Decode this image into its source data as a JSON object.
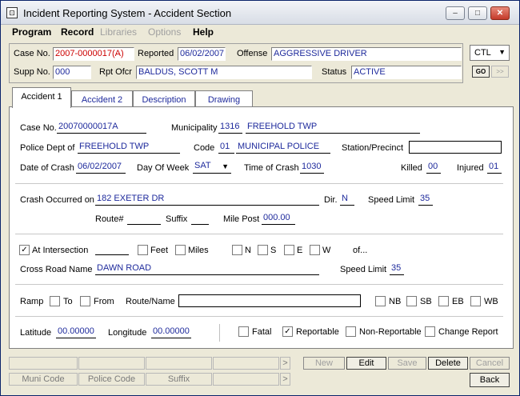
{
  "window": {
    "title": "Incident Reporting System - Accident Section",
    "controls": {
      "minimize": "‒",
      "maximize": "□",
      "close": "✕"
    }
  },
  "menu": [
    {
      "label": "Program",
      "enabled": true
    },
    {
      "label": "Record",
      "enabled": true
    },
    {
      "label": "Libraries",
      "enabled": false
    },
    {
      "label": "Options",
      "enabled": false
    },
    {
      "label": "Help",
      "enabled": true
    }
  ],
  "header": {
    "case_no_label": "Case No.",
    "case_no": "2007-0000017(A)",
    "reported_label": "Reported",
    "reported": "06/02/2007",
    "offense_label": "Offense",
    "offense": "AGGRESSIVE DRIVER",
    "supp_no_label": "Supp No.",
    "supp_no": "000",
    "rpt_ofcr_label": "Rpt Ofcr",
    "rpt_ofcr": "BALDUS, SCOTT M",
    "status_label": "Status",
    "status": "ACTIVE",
    "ctl_select": "CTL",
    "go_label": "GO",
    "next_label": ">>"
  },
  "tabs": [
    {
      "label": "Accident 1",
      "active": true
    },
    {
      "label": "Accident 2",
      "active": false
    },
    {
      "label": "Description",
      "active": false
    },
    {
      "label": "Drawing",
      "active": false
    }
  ],
  "form": {
    "case_no_label": "Case No.",
    "case_no": "20070000017A",
    "municipality_label": "Municipality",
    "municipality_code": "1316",
    "municipality_name": "FREEHOLD TWP",
    "police_dept_label": "Police Dept of",
    "police_dept": "FREEHOLD TWP",
    "code_label": "Code",
    "code": "01",
    "code_name": "MUNICIPAL POLICE",
    "station_label": "Station/Precinct",
    "station": "",
    "date_label": "Date of Crash",
    "date": "06/02/2007",
    "dow_label": "Day Of Week",
    "dow": "SAT",
    "time_label": "Time of Crash",
    "time": "1030",
    "killed_label": "Killed",
    "killed": "00",
    "injured_label": "Injured",
    "injured": "01",
    "occurred_label": "Crash Occurred on",
    "occurred": "182 EXETER DR",
    "dir_label": "Dir.",
    "dir": "N",
    "speed_label": "Speed Limit",
    "speed": "35",
    "route_label": "Route#",
    "route": "",
    "suffix_label": "Suffix",
    "suffix": "",
    "milepost_label": "Mile Post",
    "milepost": "000.00",
    "intersection_label": "At Intersection",
    "intersection_checked": true,
    "distance": "",
    "feet_label": "Feet",
    "miles_label": "Miles",
    "n_label": "N",
    "s_label": "S",
    "e_label": "E",
    "w_label": "W",
    "of_label": "of...",
    "cross_label": "Cross Road Name",
    "cross_road": "DAWN ROAD",
    "cross_speed_label": "Speed Limit",
    "cross_speed": "35",
    "ramp_label": "Ramp",
    "to_label": "To",
    "from_label": "From",
    "route_name_label": "Route/Name",
    "route_name": "",
    "nb_label": "NB",
    "sb_label": "SB",
    "eb_label": "EB",
    "wb_label": "WB",
    "lat_label": "Latitude",
    "lat": "00.00000",
    "lon_label": "Longitude",
    "lon": "00.00000",
    "fatal_label": "Fatal",
    "reportable_label": "Reportable",
    "reportable_checked": true,
    "nonreportable_label": "Non-Reportable",
    "change_label": "Change Report"
  },
  "footer": {
    "muni_code": "Muni Code",
    "police_code": "Police Code",
    "suffix": "Suffix",
    "arrow": ">",
    "new": "New",
    "edit": "Edit",
    "save": "Save",
    "delete": "Delete",
    "cancel": "Cancel",
    "back": "Back"
  }
}
